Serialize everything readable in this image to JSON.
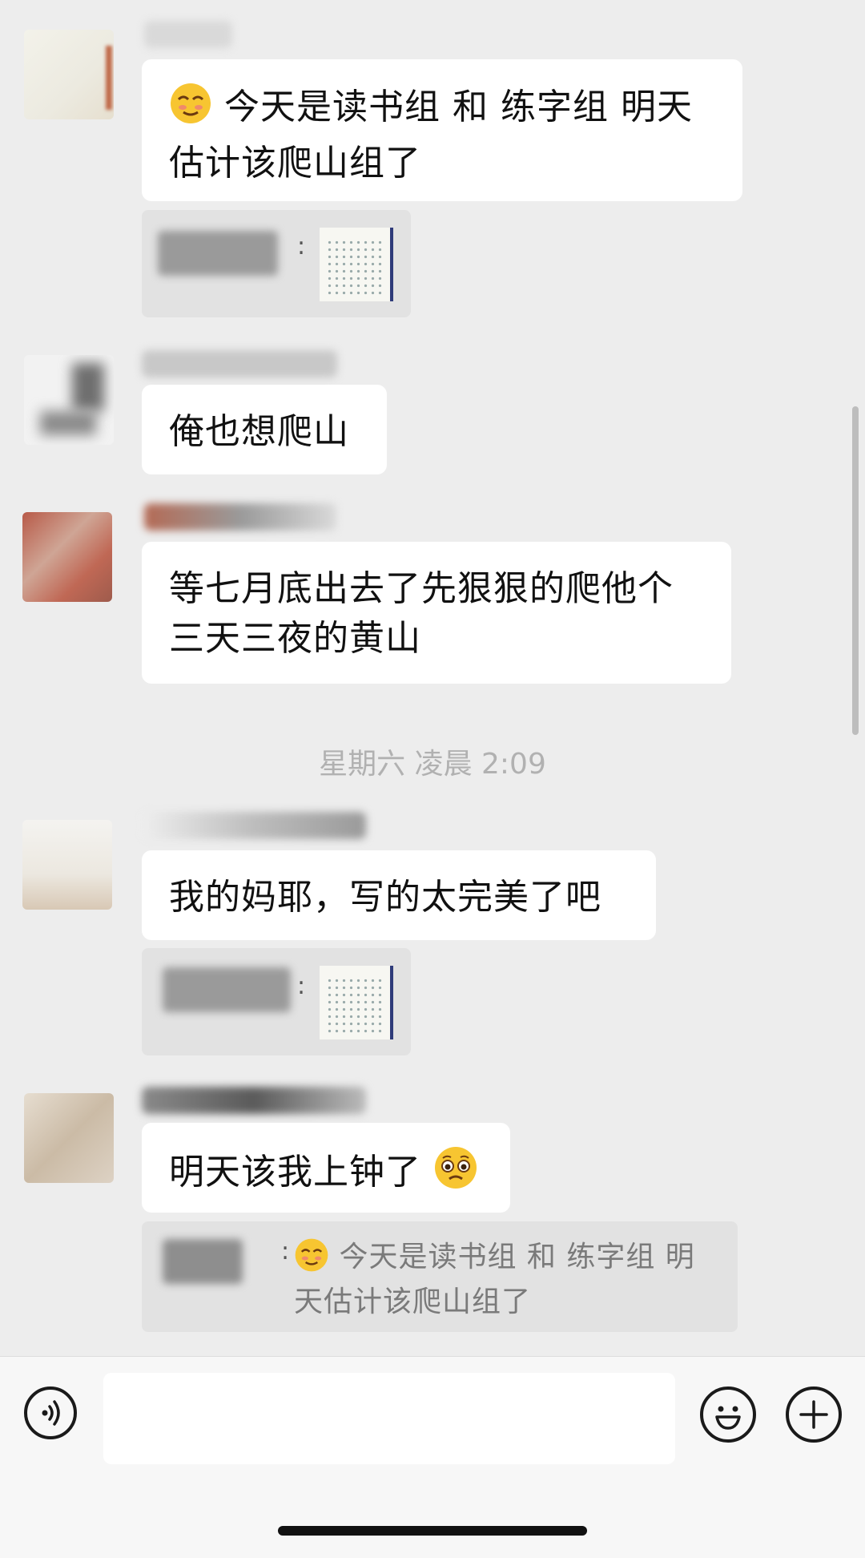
{
  "messages": [
    {
      "text": "今天是读书组 和 练字组 明天估计该爬山组了"
    },
    {
      "text": "俺也想爬山"
    },
    {
      "text": "等七月底出去了先狠狠的爬他个三天三夜的黄山"
    },
    {
      "text": "我的妈耶，写的太完美了吧"
    },
    {
      "text": "明天该我上钟了"
    }
  ],
  "quotes": [
    {
      "colon": ":"
    },
    {
      "colon": ":"
    },
    {
      "colon": ":",
      "text": "今天是读书组 和 练字组 明天估计该爬山组了"
    }
  ],
  "timestamp": "星期六 凌晨 2:09",
  "input": {
    "placeholder": ""
  },
  "icons": [
    "voice-icon",
    "smiley-emoji-icon",
    "pleading-emoji-icon",
    "emoji-icon",
    "plus-icon"
  ],
  "colors": {
    "background": "#ededed",
    "bubble": "#ffffff",
    "quote_bg": "#e2e2e2",
    "timestamp": "#b1b1b1"
  }
}
